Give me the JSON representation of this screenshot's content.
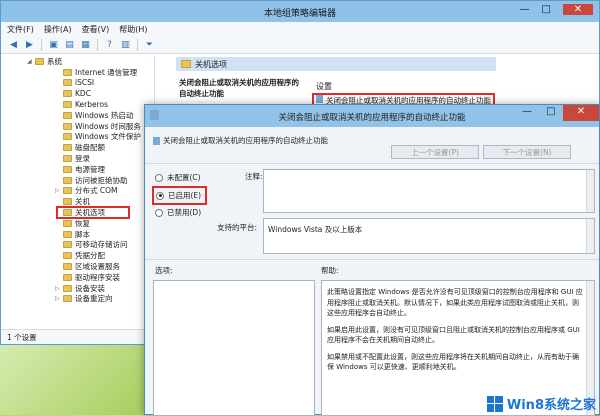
{
  "main_window": {
    "title": "本地组策略编辑器",
    "menu": [
      "文件(F)",
      "操作(A)",
      "查看(V)",
      "帮助(H)"
    ],
    "status": "1 个设置"
  },
  "tree": {
    "items": [
      {
        "label": "系统",
        "indent": 0,
        "expanded": true
      },
      {
        "label": "Internet 通信管理",
        "indent": 1
      },
      {
        "label": "iSCSI",
        "indent": 1
      },
      {
        "label": "KDC",
        "indent": 1
      },
      {
        "label": "Kerberos",
        "indent": 1
      },
      {
        "label": "Windows 热启动",
        "indent": 1
      },
      {
        "label": "Windows 时间服务",
        "indent": 1
      },
      {
        "label": "Windows 文件保护",
        "indent": 1
      },
      {
        "label": "磁盘配额",
        "indent": 1
      },
      {
        "label": "登录",
        "indent": 1
      },
      {
        "label": "电源管理",
        "indent": 1
      },
      {
        "label": "访问被拒绝协助",
        "indent": 1
      },
      {
        "label": "分布式 COM",
        "indent": 1
      },
      {
        "label": "关机",
        "indent": 1
      },
      {
        "label": "关机选项",
        "indent": 1,
        "selected": true
      },
      {
        "label": "恢复",
        "indent": 1
      },
      {
        "label": "脚本",
        "indent": 1
      },
      {
        "label": "可移动存储访问",
        "indent": 1
      },
      {
        "label": "凭据分配",
        "indent": 1
      },
      {
        "label": "区域设置服务",
        "indent": 1
      },
      {
        "label": "驱动程序安装",
        "indent": 1
      },
      {
        "label": "设备安装",
        "indent": 1
      },
      {
        "label": "设备重定向",
        "indent": 1
      }
    ]
  },
  "right_panel": {
    "header": "关机选项",
    "policy_name": "关闭会阻止或取消关机的应用程序的自动终止功能",
    "setting_header": "设置",
    "setting_row": "关闭会阻止或取消关机的应用程序的自动终止功能"
  },
  "dialog": {
    "title": "关闭会阻止或取消关机的应用程序的自动终止功能",
    "subtitle": "关闭会阻止或取消关机的应用程序的自动终止功能",
    "prev_button": "上一个设置(P)",
    "next_button": "下一个设置(N)",
    "radio_not_configured": "未配置(C)",
    "radio_enabled": "已启用(E)",
    "radio_disabled": "已禁用(D)",
    "comment_label": "注释:",
    "platform_label": "支持的平台:",
    "platform_value": "Windows Vista 及以上版本",
    "options_label": "选项:",
    "help_label": "帮助:",
    "help_p1": "此策略设置指定 Windows 是否允许没有可见顶级窗口的控制台应用程序和 GUI 应用程序阻止或取消关机。默认情况下，如果此类应用程序试图取消或阻止关机，则这些应用程序会自动终止。",
    "help_p2": "如果启用此设置，则没有可见顶级窗口且阻止或取消关机的控制台应用程序或 GUI 应用程序不会在关机期间自动终止。",
    "help_p3": "如果禁用或不配置此设置，则这些应用程序将在关机期间自动终止，从而有助于确保 Windows 可以更快速、更顺利地关机。"
  },
  "watermark": {
    "text": "Win8系统之家"
  }
}
